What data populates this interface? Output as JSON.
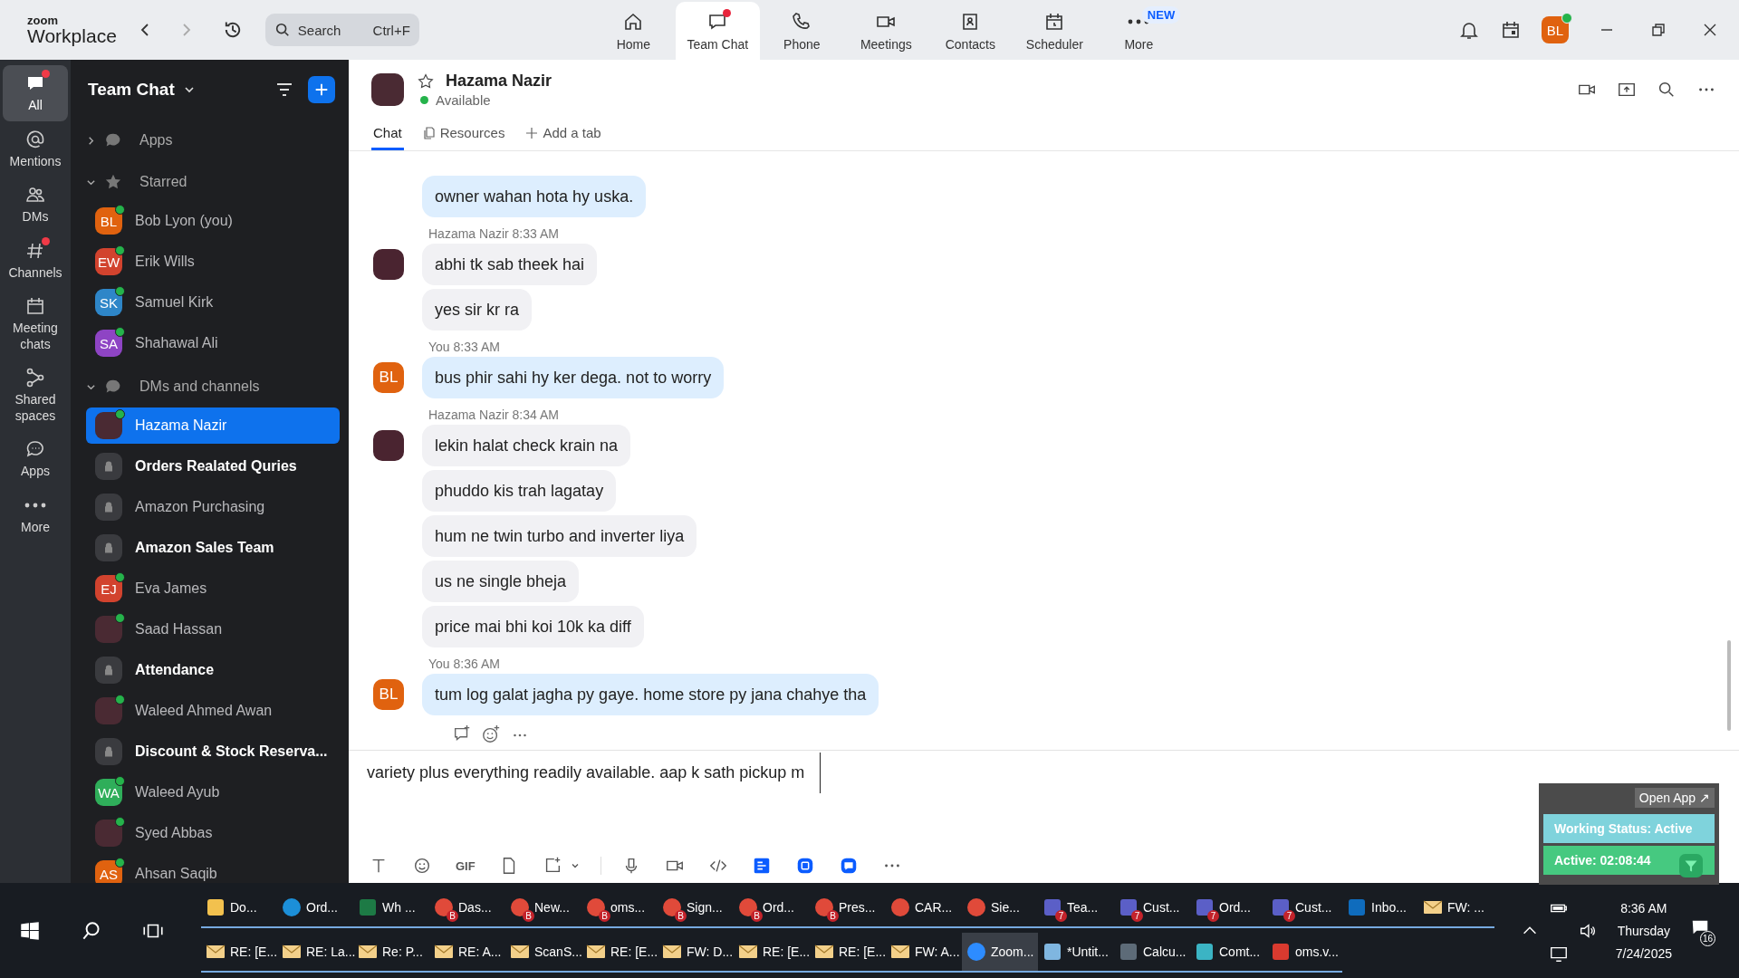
{
  "app": {
    "brand_top": "zoom",
    "brand_bottom": "Workplace",
    "search": {
      "placeholder": "Search",
      "shortcut": "Ctrl+F"
    }
  },
  "nav": [
    {
      "label": "Home",
      "kind": "home",
      "selected": false,
      "alert": false
    },
    {
      "label": "Team Chat",
      "kind": "chat",
      "selected": true,
      "alert": true
    },
    {
      "label": "Phone",
      "kind": "phone",
      "selected": false,
      "alert": false
    },
    {
      "label": "Meetings",
      "kind": "meetings",
      "selected": false,
      "alert": false
    },
    {
      "label": "Contacts",
      "kind": "contacts",
      "selected": false,
      "alert": false
    },
    {
      "label": "Scheduler",
      "kind": "scheduler",
      "selected": false,
      "alert": false
    },
    {
      "label": "More",
      "kind": "more",
      "selected": false,
      "alert": false,
      "badge": "NEW"
    }
  ],
  "profile": {
    "initials": "BL",
    "online": true
  },
  "rail": [
    {
      "label": "All",
      "kind": "all",
      "selected": true,
      "alert": true
    },
    {
      "label": "Mentions",
      "kind": "mentions",
      "selected": false,
      "alert": false
    },
    {
      "label": "DMs",
      "kind": "dms",
      "selected": false,
      "alert": false
    },
    {
      "label": "Channels",
      "kind": "channels",
      "selected": false,
      "alert": true
    },
    {
      "label": "Meeting chats",
      "kind": "meeting",
      "selected": false,
      "alert": false
    },
    {
      "label": "Shared spaces",
      "kind": "shared",
      "selected": false,
      "alert": false
    },
    {
      "label": "Apps",
      "kind": "apps",
      "selected": false,
      "alert": false
    },
    {
      "label": "More",
      "kind": "more",
      "selected": false,
      "alert": false
    }
  ],
  "sidebar": {
    "title": "Team Chat",
    "sections": [
      {
        "label": "Apps",
        "kind": "apps",
        "expanded": false
      },
      {
        "label": "Starred",
        "kind": "starred",
        "expanded": true,
        "items": [
          {
            "name": "Bob Lyon (you)",
            "kind": "person",
            "initials": "BL",
            "color": "#e0620f",
            "online": true,
            "selected": false,
            "unread": false
          },
          {
            "name": "Erik Wills",
            "kind": "person",
            "initials": "EW",
            "color": "#d2432e",
            "online": true,
            "selected": false,
            "unread": false
          },
          {
            "name": "Samuel Kirk",
            "kind": "person",
            "initials": "SK",
            "color": "#2e86c8",
            "online": true,
            "selected": false,
            "unread": false
          },
          {
            "name": "Shahawal Ali",
            "kind": "person",
            "initials": "SA",
            "color": "#8e44c4",
            "online": true,
            "selected": false,
            "unread": false
          }
        ]
      },
      {
        "label": "DMs and channels",
        "kind": "dms",
        "expanded": true,
        "items": [
          {
            "name": "Hazama Nazir",
            "kind": "photo",
            "online": true,
            "selected": true,
            "unread": false
          },
          {
            "name": "Orders Realated Quries",
            "kind": "channel",
            "selected": false,
            "unread": true
          },
          {
            "name": "Amazon Purchasing",
            "kind": "channel",
            "selected": false,
            "unread": false
          },
          {
            "name": "Amazon Sales Team",
            "kind": "channel",
            "selected": false,
            "unread": true
          },
          {
            "name": "Eva James",
            "kind": "person",
            "initials": "EJ",
            "color": "#d2432e",
            "online": true,
            "selected": false,
            "unread": false
          },
          {
            "name": "Saad Hassan",
            "kind": "photo",
            "online": true,
            "selected": false,
            "unread": false
          },
          {
            "name": "Attendance",
            "kind": "channel",
            "selected": false,
            "unread": true
          },
          {
            "name": "Waleed Ahmed Awan",
            "kind": "photo",
            "online": true,
            "selected": false,
            "unread": false
          },
          {
            "name": "Discount & Stock Reserva...",
            "kind": "channel",
            "selected": false,
            "unread": true
          },
          {
            "name": "Waleed Ayub",
            "kind": "person",
            "initials": "WA",
            "color": "#2fae5a",
            "online": true,
            "selected": false,
            "unread": false
          },
          {
            "name": "Syed Abbas",
            "kind": "photo",
            "online": true,
            "selected": false,
            "unread": false
          },
          {
            "name": "Ahsan Saqib",
            "kind": "person",
            "initials": "AS",
            "color": "#e0620f",
            "online": true,
            "selected": false,
            "unread": false
          }
        ]
      }
    ]
  },
  "chat": {
    "name": "Hazama Nazir",
    "status": "Available",
    "online": true,
    "starred": false,
    "tabs": [
      {
        "label": "Chat",
        "kind": "chat",
        "selected": true
      },
      {
        "label": "Resources",
        "kind": "resources",
        "selected": false
      },
      {
        "label": "Add a tab",
        "kind": "add",
        "selected": false
      }
    ],
    "groups": [
      {
        "kind": "self",
        "bubbles": [
          "owner wahan hota hy uska."
        ]
      },
      {
        "kind": "other",
        "sender": "Hazama Nazir",
        "time": "8:33 AM",
        "bubbles": [
          "abhi tk sab theek hai",
          "yes sir kr ra"
        ]
      },
      {
        "kind": "self",
        "sender": "You",
        "time": "8:33 AM",
        "initials": "BL",
        "bubbles": [
          "bus phir sahi hy ker dega. not to worry"
        ]
      },
      {
        "kind": "other",
        "sender": "Hazama Nazir",
        "time": "8:34 AM",
        "bubbles": [
          "lekin halat check krain na",
          "phuddo kis trah lagatay",
          "hum ne twin turbo and inverter liya",
          "us ne single bheja",
          "price mai bhi koi 10k ka diff"
        ]
      },
      {
        "kind": "self",
        "sender": "You",
        "time": "8:36 AM",
        "initials": "BL",
        "bubbles": [
          "tum log galat jagha py gaye. home store py jana chahye tha"
        ]
      }
    ]
  },
  "composer": {
    "value": "variety plus everything readily available. aap k sath pickup m",
    "gif_label": "GIF"
  },
  "widget": {
    "open_app": "Open App ↗",
    "status": "Working Status: Active",
    "timer": "Active: 02:08:44"
  },
  "taskbar": {
    "rows": [
      [
        {
          "label": "Do...",
          "kind": "folder",
          "selected": false
        },
        {
          "label": "Ord...",
          "kind": "edge",
          "selected": false
        },
        {
          "label": "Wh ...",
          "kind": "excel",
          "selected": false
        },
        {
          "label": "Das...",
          "kind": "chrome",
          "badge": "B",
          "selected": false
        },
        {
          "label": "New...",
          "kind": "chrome",
          "badge": "B",
          "selected": false
        },
        {
          "label": "oms...",
          "kind": "chrome",
          "badge": "B",
          "selected": false
        },
        {
          "label": "Sign...",
          "kind": "chrome",
          "badge": "B",
          "selected": false
        },
        {
          "label": "Ord...",
          "kind": "chrome",
          "badge": "B",
          "selected": false
        },
        {
          "label": "Pres...",
          "kind": "chrome",
          "badge": "B",
          "selected": false
        },
        {
          "label": "CAR...",
          "kind": "chrome",
          "selected": false
        },
        {
          "label": "Sie...",
          "kind": "chrome",
          "selected": false
        },
        {
          "label": "Tea...",
          "kind": "teams",
          "badge": "7",
          "selected": false
        },
        {
          "label": "Cust...",
          "kind": "teams",
          "badge": "7",
          "selected": false
        },
        {
          "label": "Ord...",
          "kind": "teams",
          "badge": "7",
          "selected": false
        },
        {
          "label": "Cust...",
          "kind": "teams",
          "badge": "7",
          "selected": false
        },
        {
          "label": "Inbo...",
          "kind": "outlook",
          "selected": false
        },
        {
          "label": "FW: ...",
          "kind": "mail",
          "selected": false
        }
      ],
      [
        {
          "label": "RE: [E...",
          "kind": "mail",
          "selected": false
        },
        {
          "label": "RE: La...",
          "kind": "mail",
          "selected": false
        },
        {
          "label": "Re: P...",
          "kind": "mail",
          "selected": false
        },
        {
          "label": "RE: A...",
          "kind": "mail",
          "selected": false
        },
        {
          "label": "ScanS...",
          "kind": "mail",
          "selected": false
        },
        {
          "label": "RE: [E...",
          "kind": "mail",
          "selected": false
        },
        {
          "label": "FW: D...",
          "kind": "mail",
          "selected": false
        },
        {
          "label": "RE: [E...",
          "kind": "mail",
          "selected": false
        },
        {
          "label": "RE: [E...",
          "kind": "mail",
          "selected": false
        },
        {
          "label": "FW: A...",
          "kind": "mail",
          "selected": false
        },
        {
          "label": "Zoom...",
          "kind": "zoom",
          "selected": true
        },
        {
          "label": "*Untit...",
          "kind": "notepad",
          "selected": false
        },
        {
          "label": "Calcu...",
          "kind": "calc",
          "selected": false
        },
        {
          "label": "Comt...",
          "kind": "app",
          "selected": false
        },
        {
          "label": "oms.v...",
          "kind": "pdf",
          "selected": false
        }
      ]
    ],
    "time": "8:36 AM",
    "day": "Thursday",
    "date": "7/24/2025",
    "notifications": "16"
  }
}
